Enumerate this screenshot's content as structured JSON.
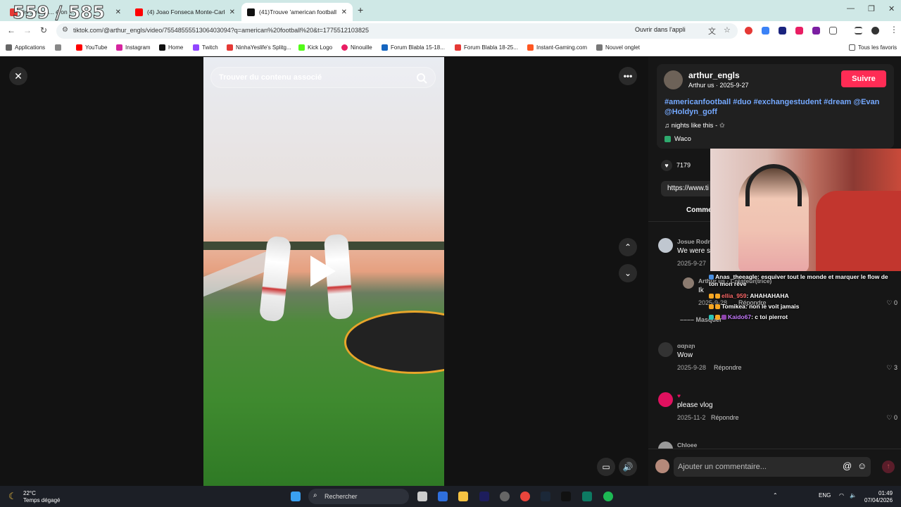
{
  "overlay_counter": "559 / 585",
  "browser": {
    "tabs": [
      {
        "label": "és Stream... é on ...",
        "favicon_color": "#e53935"
      },
      {
        "label": "(4) Joao Fonseca Monte-Carlo",
        "favicon_color": "#ff0000"
      },
      {
        "label": "(41)Trouve 'american football",
        "favicon_color": "#111111"
      }
    ],
    "url": "tiktok.com/@arthur_engls/video/7554855551306403094?q=american%20football%20&t=1775512103825",
    "open_in_app": "Ouvrir dans l'appli",
    "bookmarks": [
      {
        "label": "Applications",
        "color": "#666666"
      },
      {
        "label": "YouTube",
        "color": "#ff0000"
      },
      {
        "label": "Instagram",
        "color": "#d6249f"
      },
      {
        "label": "Home",
        "color": "#111111"
      },
      {
        "label": "Twitch",
        "color": "#9146ff"
      },
      {
        "label": "NinhaYeslife's Splitg...",
        "color": "#e53935"
      },
      {
        "label": "Kick Logo",
        "color": "#53fc18"
      },
      {
        "label": "Ninouille",
        "color": "#e91e63"
      },
      {
        "label": "Forum Blabla 15-18...",
        "color": "#1565c0"
      },
      {
        "label": "Forum Blabla 18-25...",
        "color": "#e53935"
      },
      {
        "label": "Instant-Gaming.com",
        "color": "#ff5722"
      },
      {
        "label": "Nouvel onglet",
        "color": "#777777"
      },
      {
        "label": "Tous les favoris",
        "color": "#555555"
      }
    ]
  },
  "video": {
    "search_placeholder": "Trouver du contenu associé"
  },
  "post": {
    "username": "arthur_engls",
    "subline": "Arthur us · 2025-9-27",
    "follow_label": "Suivre",
    "hashtags": "#americanfootball #duo #exchangestudent #dream @Evan @Holdyn_goff",
    "music": "nights like this - ✩",
    "location": "Waco",
    "like_count": "7179",
    "link": "https://www.ti",
    "comments_tab": "Comme"
  },
  "comments": [
    {
      "author": "Josue Rodr",
      "text": "We were s",
      "date": "2025-9-27",
      "reply": "",
      "likes": ""
    },
    {
      "author": "Arthur us · Créateur(trice)",
      "text": "Ik",
      "date": "2025-9-28",
      "reply": "Répondre",
      "likes": "0"
    },
    {
      "author": "–––– Masquer",
      "text": "",
      "date": "",
      "reply": "",
      "likes": ""
    },
    {
      "author": "ɑɑɲƨɲ",
      "text": "Wow",
      "date": "2025-9-28",
      "reply": "Répondre",
      "likes": "3"
    },
    {
      "author": "♥",
      "text": "please vlog",
      "date": "2025-11-2",
      "reply": "Répondre",
      "likes": "0"
    },
    {
      "author": "Chloee",
      "text": "",
      "date": "",
      "reply": "",
      "likes": ""
    }
  ],
  "comment_input_placeholder": "Ajouter un commentaire...",
  "chat": [
    {
      "user": "Anas_theeagle",
      "message": "esquiver tout le monde et marquer le flow de ton mon rêve",
      "user_color": "#ffffff"
    },
    {
      "user": "ellia_959",
      "message": "AHAHAHAHA",
      "user_color": "#ff6b6b"
    },
    {
      "user": "Tomikea",
      "message": "non le voit jamais",
      "user_color": "#ffffff"
    },
    {
      "user": "Kaido67",
      "message": "c toi pierrot",
      "user_color": "#c77dff"
    }
  ],
  "taskbar": {
    "temperature": "22°C",
    "weather": "Temps dégagé",
    "search": "Rechercher",
    "lang": "ENG",
    "time": "01:49",
    "date": "07/04/2026"
  }
}
